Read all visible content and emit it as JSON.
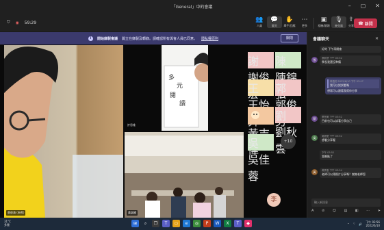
{
  "window": {
    "title": "「General」中的會議"
  },
  "toolbar": {
    "timer": "59:29",
    "buttons": [
      {
        "label": "人員",
        "icon": "people-icon"
      },
      {
        "label": "聊天",
        "icon": "chat-icon"
      },
      {
        "label": "舉手/回應",
        "icon": "raise-hand-icon"
      },
      {
        "label": "更多",
        "icon": "more-icon"
      },
      {
        "label": "相機/鏡頭",
        "icon": "camera-icon"
      },
      {
        "label": "麥克風",
        "icon": "mic-icon"
      },
      {
        "label": "分享",
        "icon": "share-icon"
      }
    ],
    "leave_label": "離開"
  },
  "banner": {
    "text_bold": "開始錄製會議",
    "text": "開立在錄製及轉錄。請確認所有與會人員已同意。",
    "link": "隱私權原則",
    "dismiss": "關閉"
  },
  "videos": {
    "v1_name": "蔡俊清 (來賓)",
    "v3_name": "黃誠國",
    "v2_name": "許思維"
  },
  "avatars": [
    {
      "char": "謝",
      "name": "謝俊宏",
      "color": "#f2c6c6"
    },
    {
      "char": "陳",
      "name": "陳錦弘",
      "color": "#cfe8c7"
    },
    {
      "char": "王",
      "name": "王怡舜",
      "color": "#f7dfa8"
    },
    {
      "char": "郭",
      "name": "郭俊男",
      "color": "#f2c6c6"
    },
    {
      "char": "",
      "name": "黃吉偉",
      "color": "#f3c8a0"
    },
    {
      "char": "劉",
      "name": "劉秋雲",
      "color": "#f2c6c6"
    },
    {
      "char": "吳",
      "name": "吳佳蓉",
      "color": "#cfe8c7"
    }
  ],
  "more_count": "+10",
  "self_char": "李",
  "chat": {
    "title": "會議聊天",
    "messages": [
      {
        "meta": "",
        "text": "好的 下午再開會",
        "mine": false,
        "avatar": ""
      },
      {
        "meta": "張凱慧 下午 03:52",
        "text": "學長我還沒準備",
        "mine": false,
        "avatar": "張"
      },
      {
        "meta": "林昌鈞 2022/6/10 下午 03:47",
        "text": "我可以試試看嗎",
        "mine": true,
        "extra": "想寫可以跟著我幫你分享"
      },
      {
        "meta": "蔡慧美 下午 03:52",
        "text": "目前也可以試著分享自己",
        "mine": false,
        "avatar": "蔡"
      },
      {
        "meta": "吳雅瑩 下午 03:52",
        "text": "想看分享喔",
        "mine": false,
        "avatar": "吳"
      },
      {
        "meta": "下午 03:52",
        "text": "我晚點了",
        "mine": false,
        "avatar": ""
      },
      {
        "meta": "黃秀惠 下午 03:54",
        "text": "老師可以傳照片分享嗎？謝謝老師您",
        "mine": false,
        "avatar": "黃"
      }
    ],
    "compose_placeholder": "輸入新訊息"
  },
  "taskbar": {
    "weather_temp": "31°C",
    "weather_desc": "多雲",
    "time": "下午 03:56",
    "date": "2022/6/10"
  }
}
